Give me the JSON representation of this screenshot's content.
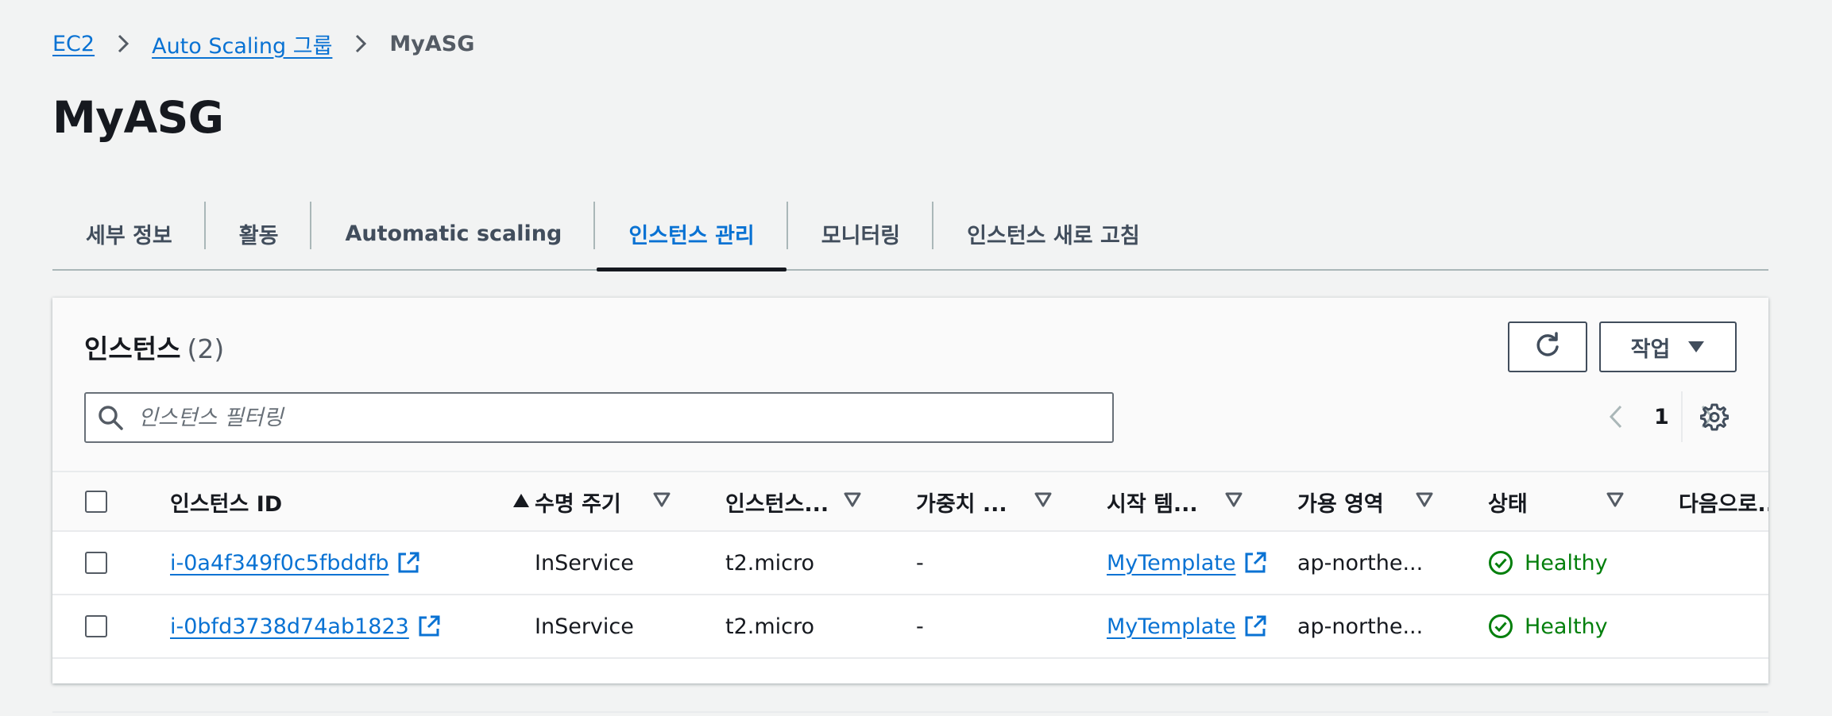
{
  "breadcrumb": {
    "items": [
      "EC2",
      "Auto Scaling 그룹"
    ],
    "current": "MyASG"
  },
  "page_title": "MyASG",
  "tabs": [
    {
      "label": "세부 정보"
    },
    {
      "label": "활동"
    },
    {
      "label": "Automatic scaling"
    },
    {
      "label": "인스턴스 관리",
      "active": true
    },
    {
      "label": "모니터링"
    },
    {
      "label": "인스턴스 새로 고침"
    }
  ],
  "panel": {
    "title": "인스턴스",
    "count": "(2)",
    "actions_label": "작업",
    "search_placeholder": "인스턴스 필터링",
    "page": "1"
  },
  "columns": [
    "인스턴스 ID",
    "수명 주기",
    "인스턴스...",
    "가중치 ...",
    "시작 템...",
    "가용 영역",
    "상태",
    "다음으로..."
  ],
  "rows": [
    {
      "id": "i-0a4f349f0c5fbddfb",
      "lifecycle": "InService",
      "type": "t2.micro",
      "weight": "-",
      "template": "MyTemplate",
      "az": "ap-northe...",
      "status": "Healthy"
    },
    {
      "id": "i-0bfd3738d74ab1823",
      "lifecycle": "InService",
      "type": "t2.micro",
      "weight": "-",
      "template": "MyTemplate",
      "az": "ap-northe...",
      "status": "Healthy"
    }
  ],
  "colors": {
    "link": "#0972d3",
    "healthy": "#037f0c",
    "text": "#16191f"
  }
}
